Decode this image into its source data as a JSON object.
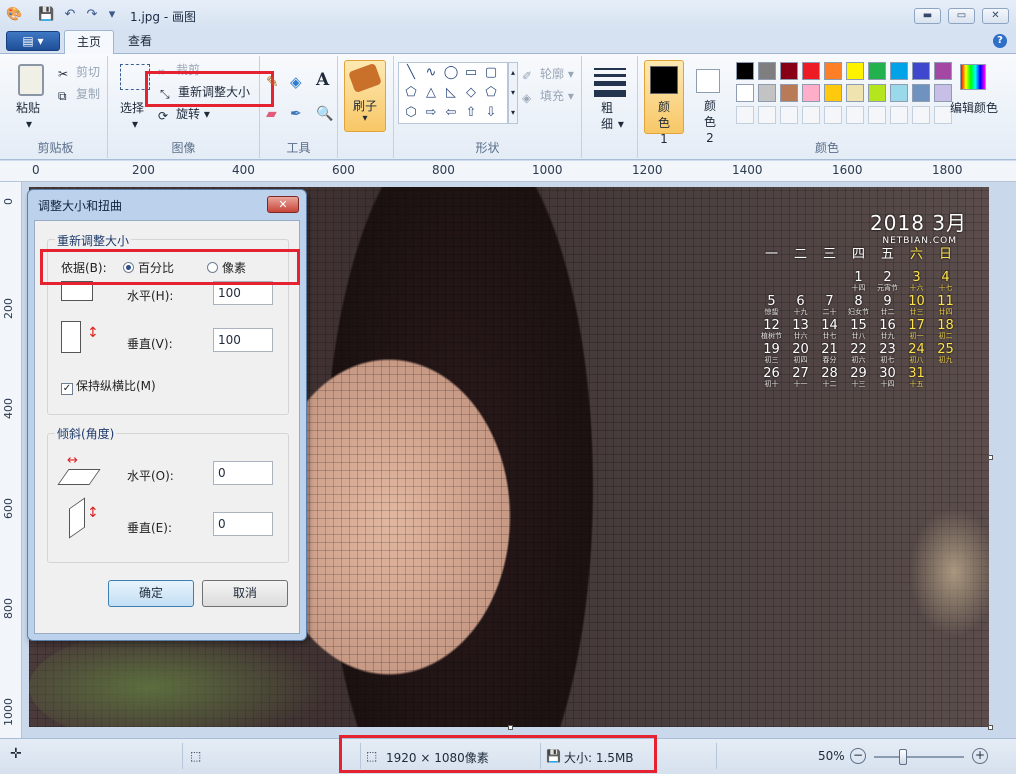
{
  "titlebar": {
    "title": "1.jpg - 画图",
    "minimize": "▬",
    "maximize": "▭",
    "close": "✕"
  },
  "tabs": {
    "menu": "▤ ▾",
    "home": "主页",
    "view": "查看",
    "help": "?"
  },
  "ribbon": {
    "clipboard": {
      "label": "剪贴板",
      "paste": "粘贴",
      "cut": "剪切",
      "copy": "复制"
    },
    "image": {
      "label": "图像",
      "select": "选择",
      "crop": "裁剪",
      "resize": "重新调整大小",
      "rotate": "旋转"
    },
    "tools": {
      "label": "工具",
      "text": "A"
    },
    "brushes": {
      "label": "刷子"
    },
    "shapes": {
      "label": "形状",
      "outline": "轮廓",
      "fill": "填充"
    },
    "size": {
      "label": "粗细"
    },
    "colors": {
      "label": "颜色",
      "color1": "颜色 1",
      "color2": "颜色 2",
      "edit": "编辑颜色",
      "palette": [
        "#000000",
        "#7f7f7f",
        "#880015",
        "#ed1c24",
        "#ff7f27",
        "#fff200",
        "#22b14c",
        "#00a2e8",
        "#3f48cc",
        "#a349a4",
        "#ffffff",
        "#c3c3c3",
        "#b97a57",
        "#ffaec9",
        "#ffc90e",
        "#efe4b0",
        "#b5e61d",
        "#99d9ea",
        "#7092be",
        "#c8bfe7"
      ]
    }
  },
  "ruler": {
    "top": [
      "0",
      "200",
      "400",
      "600",
      "800",
      "1000",
      "1200",
      "1400",
      "1600",
      "1800"
    ],
    "left": [
      "0",
      "200",
      "400",
      "600",
      "800",
      "1000"
    ]
  },
  "dialog": {
    "title": "调整大小和扭曲",
    "close": "✕",
    "resize_group": "重新调整大小",
    "by_label": "依据(B):",
    "percent": "百分比",
    "pixels": "像素",
    "horizontal_label": "水平(H):",
    "horizontal_value": "100",
    "vertical_label": "垂直(V):",
    "vertical_value": "100",
    "keep_ratio": "保持纵横比(M)",
    "skew_group": "倾斜(角度)",
    "skew_h_label": "水平(O):",
    "skew_h_value": "0",
    "skew_v_label": "垂直(E):",
    "skew_v_value": "0",
    "ok": "确定",
    "cancel": "取消"
  },
  "calendar": {
    "title": "2018 3月",
    "site": "NETBIAN.COM",
    "weekdays": [
      "一",
      "二",
      "三",
      "四",
      "五",
      "六",
      "日"
    ],
    "rows": [
      [
        [
          "",
          ""
        ],
        [
          "",
          ""
        ],
        [
          "",
          ""
        ],
        [
          "1",
          "十四"
        ],
        [
          "2",
          "元宵节"
        ],
        [
          "3",
          "十六"
        ],
        [
          "4",
          "十七"
        ]
      ],
      [
        [
          "5",
          "惊蛰"
        ],
        [
          "6",
          "十九"
        ],
        [
          "7",
          "二十"
        ],
        [
          "8",
          "妇女节"
        ],
        [
          "9",
          "廿二"
        ],
        [
          "10",
          "廿三"
        ],
        [
          "11",
          "廿四"
        ]
      ],
      [
        [
          "12",
          "植树节"
        ],
        [
          "13",
          "廿六"
        ],
        [
          "14",
          "廿七"
        ],
        [
          "15",
          "廿八"
        ],
        [
          "16",
          "廿九"
        ],
        [
          "17",
          "初一"
        ],
        [
          "18",
          "初二"
        ]
      ],
      [
        [
          "19",
          "初三"
        ],
        [
          "20",
          "初四"
        ],
        [
          "21",
          "春分"
        ],
        [
          "22",
          "初六"
        ],
        [
          "23",
          "初七"
        ],
        [
          "24",
          "初八"
        ],
        [
          "25",
          "初九"
        ]
      ],
      [
        [
          "26",
          "初十"
        ],
        [
          "27",
          "十一"
        ],
        [
          "28",
          "十二"
        ],
        [
          "29",
          "十三"
        ],
        [
          "30",
          "十四"
        ],
        [
          "31",
          "十五"
        ],
        [
          "",
          ""
        ]
      ]
    ]
  },
  "status": {
    "dimensions": "1920 × 1080像素",
    "size": "大小: 1.5MB",
    "zoom": "50%",
    "zoom_level": 0.5
  }
}
